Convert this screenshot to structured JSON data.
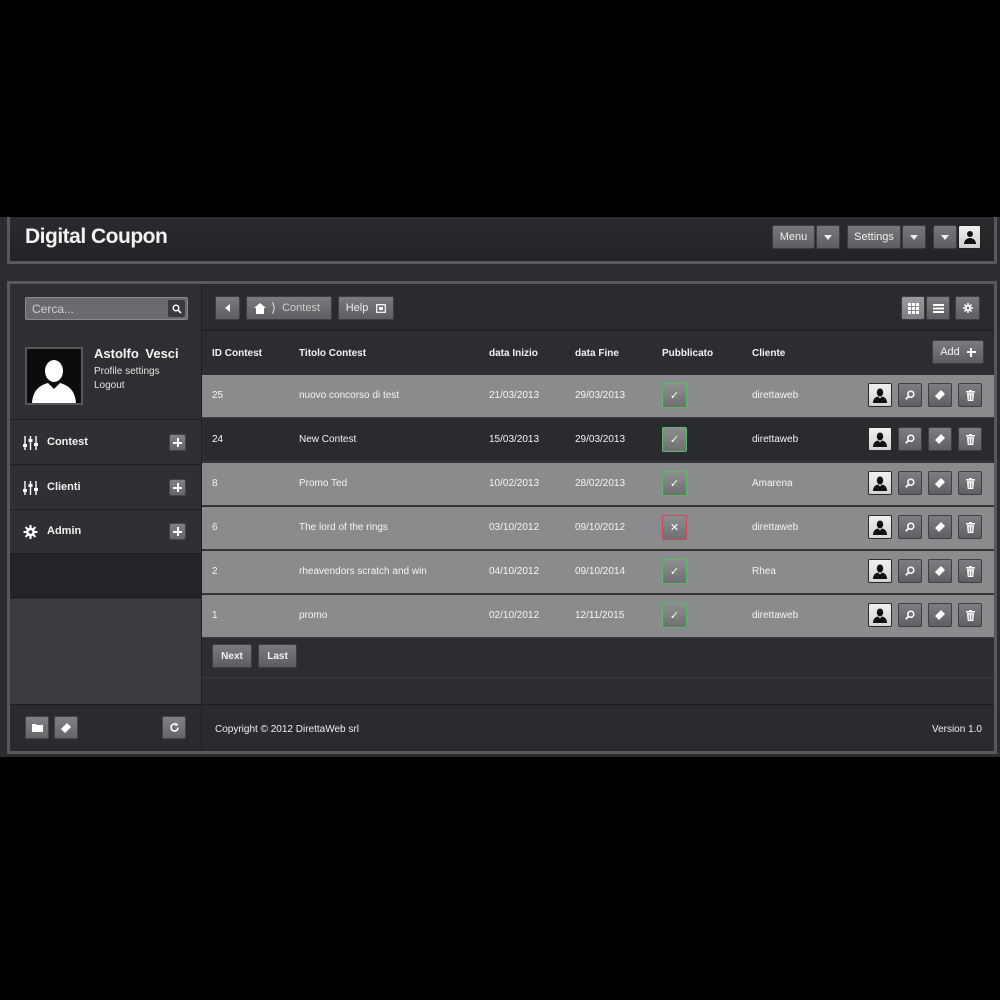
{
  "header": {
    "title": "Digital Coupon",
    "menu_label": "Menu",
    "settings_label": "Settings"
  },
  "sidebar": {
    "search_placeholder": "Cerca...",
    "user": {
      "name": "Astolfo Vesci",
      "profile_settings": "Profile settings",
      "logout": "Logout"
    },
    "items": [
      {
        "label": "Contest",
        "icon": "sliders-icon"
      },
      {
        "label": "Clienti",
        "icon": "sliders-icon"
      },
      {
        "label": "Admin",
        "icon": "gear-icon"
      }
    ]
  },
  "toolbar": {
    "breadcrumb": "Contest",
    "help_label": "Help"
  },
  "table": {
    "columns": [
      "ID Contest",
      "Titolo Contest",
      "data Inizio",
      "data Fine",
      "Pubblicato",
      "Cliente"
    ],
    "add_label": "Add",
    "rows": [
      {
        "id": "25",
        "title": "nuovo concorso di test",
        "start": "21/03/2013",
        "end": "29/03/2013",
        "published": true,
        "client": "direttaweb"
      },
      {
        "id": "24",
        "title": "New Contest",
        "start": "15/03/2013",
        "end": "29/03/2013",
        "published": true,
        "client": "direttaweb"
      },
      {
        "id": "8",
        "title": "Promo Ted",
        "start": "10/02/2013",
        "end": "28/02/2013",
        "published": true,
        "client": "Amarena"
      },
      {
        "id": "6",
        "title": "The lord of the rings",
        "start": "03/10/2012",
        "end": "09/10/2012",
        "published": false,
        "client": "direttaweb"
      },
      {
        "id": "2",
        "title": "rheavendors scratch and win",
        "start": "04/10/2012",
        "end": "09/10/2014",
        "published": true,
        "client": "Rhea"
      },
      {
        "id": "1",
        "title": "promo",
        "start": "02/10/2012",
        "end": "12/11/2015",
        "published": true,
        "client": "direttaweb"
      }
    ]
  },
  "pager": {
    "next_label": "Next",
    "last_label": "Last"
  },
  "footer": {
    "copyright": "Copyright © 2012 DirettaWeb srl",
    "version": "Version 1.0"
  },
  "symbols": {
    "check": "✓",
    "cross": "✕"
  },
  "colors": {
    "published_border": "#5fb86a",
    "unpublished_border": "#cc4a55",
    "row_light": "#8a8b8d",
    "row_dark": "#2a2b2e"
  }
}
